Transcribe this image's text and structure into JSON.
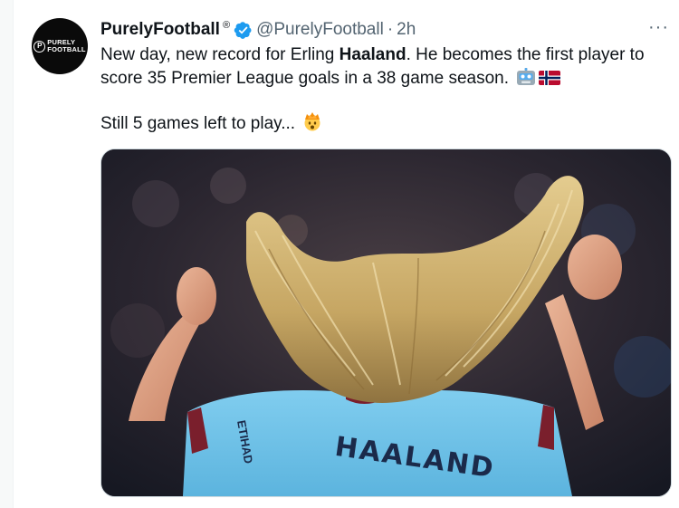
{
  "tweet": {
    "author_name": "PurelyFootball",
    "registered_mark": "®",
    "handle": "@PurelyFootball",
    "separator": "·",
    "time": "2h",
    "more_label": "···",
    "avatar": {
      "logo_letter": "P",
      "logo_line1": "PURELY",
      "logo_line2": "FOOTBALL"
    },
    "text_part1": "New day, new record for Erling ",
    "text_bold": "Haaland",
    "text_part2": ". He becomes the first player to score 35 Premier League goals in a 38 game season.",
    "text_line2": "Still 5 games left to play...",
    "emojis": [
      "robot-face",
      "norway-flag",
      "exploding-head"
    ],
    "media": {
      "shirt_name": "HAALAND",
      "sponsor": "ETIHAD",
      "alt": ""
    }
  },
  "colors": {
    "verified_blue": "#1d9bf0",
    "secondary_text": "#536471",
    "shirt_blue": "#6cc3ea",
    "shirt_text": "#1b2a4a"
  }
}
